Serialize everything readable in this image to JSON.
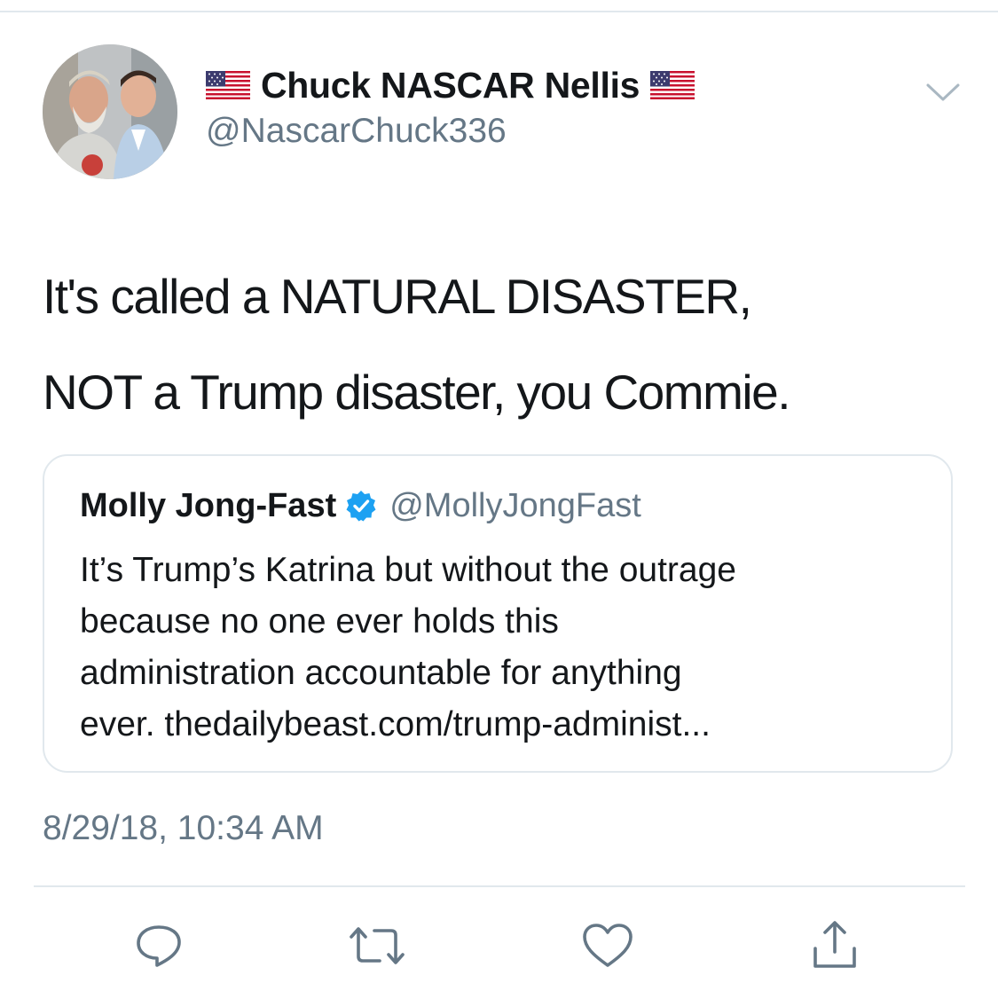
{
  "tweet": {
    "author": {
      "display_name": "Chuck NASCAR Nellis",
      "handle": "@NascarChuck336"
    },
    "text_lines": [
      "It's called a NATURAL DISASTER,",
      "NOT a Trump disaster, you Commie."
    ],
    "timestamp": "8/29/18, 10:34 AM"
  },
  "quoted_tweet": {
    "author": {
      "display_name": "Molly Jong-Fast",
      "handle": "@MollyJongFast",
      "verified": true
    },
    "text_lines": [
      "It’s Trump’s Katrina but without the outrage",
      "because no one ever holds this",
      "administration accountable for anything",
      "ever.  thedailybeast.com/trump-administ..."
    ]
  },
  "icons": {
    "flag": "us-flag-icon",
    "more": "chevron-down-icon",
    "verified": "verified-badge-icon",
    "reply": "reply-icon",
    "retweet": "retweet-icon",
    "like": "heart-icon",
    "share": "share-icon"
  },
  "colors": {
    "text_primary": "#14171a",
    "text_secondary": "#657786",
    "border": "#e1e8ed",
    "verified_blue": "#1da1f2",
    "icon_gray": "#657786"
  }
}
